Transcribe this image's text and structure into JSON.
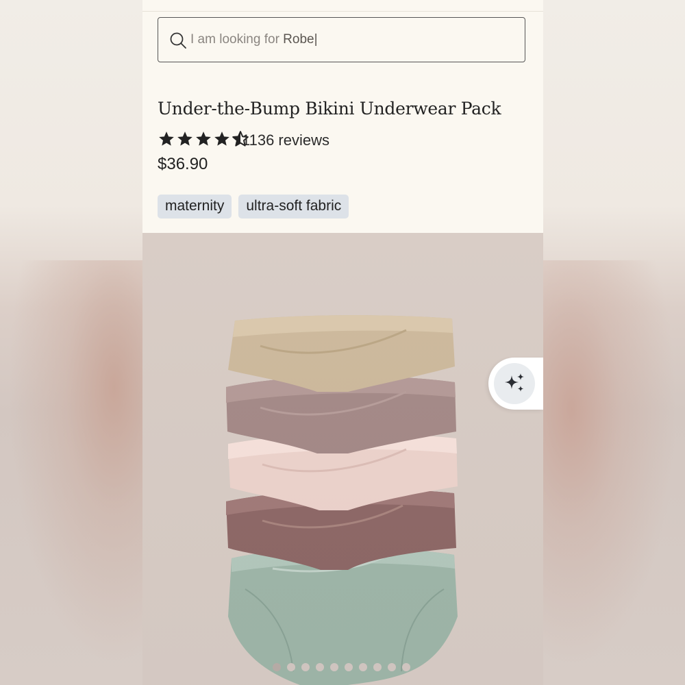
{
  "search": {
    "prefix": "I am looking for ",
    "typed": "Robe|"
  },
  "product": {
    "title": "Under-the-Bump Bikini Underwear Pack",
    "rating": 4.5,
    "review_count": "1136 reviews",
    "price": "$36.90",
    "tags": [
      "maternity",
      "ultra-soft fabric"
    ]
  },
  "gallery": {
    "dot_count": 10,
    "active_index": 0,
    "colors": [
      "#cdb99c",
      "#a48987",
      "#edd3cc",
      "#8e6867",
      "#9fb6a9"
    ]
  },
  "icons": {
    "search": "search-icon",
    "ai": "sparkles-icon"
  }
}
